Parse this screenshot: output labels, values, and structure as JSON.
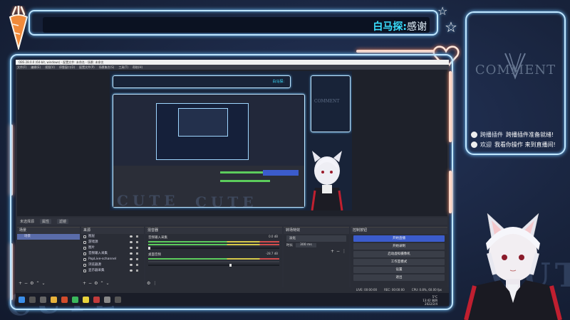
{
  "banner": {
    "name": "白马探:",
    "message": "感谢"
  },
  "comment_panel": {
    "logo_text": "COMMENT",
    "lines": [
      {
        "prefix": "跨播插件",
        "text": "跨播插件准备就绪!"
      },
      {
        "prefix": "欢迎",
        "text": "我看你操作 来到直播间!"
      }
    ]
  },
  "watermark": {
    "text": "CUTE"
  },
  "obs": {
    "title": "OBS 28.0.0 (64-bit, windows) - 配置文件: 未命名 - 场景: 未命名",
    "menu": [
      "文件(F)",
      "编辑(E)",
      "视图(V)",
      "停靠窗口(D)",
      "配置文件(P)",
      "场景集合(S)",
      "工具(T)",
      "帮助(H)"
    ],
    "scene_bar": {
      "label": "未选择源",
      "props": "属性",
      "filters": "滤镜"
    },
    "scenes": {
      "title": "场景",
      "items": [
        "场景"
      ]
    },
    "sources": {
      "title": "来源",
      "items": [
        "图层",
        "游戏源",
        "图片",
        "音频输入采集",
        "PopLive-schannel",
        "浏览器源",
        "显示器采集"
      ]
    },
    "mixer": {
      "title": "混音器",
      "channels": [
        {
          "name": "音频输入采集",
          "db": "0.0 dB",
          "level": 0.0
        },
        {
          "name": "桌面音频",
          "db": "-28.7 dB",
          "level": 0.62
        }
      ]
    },
    "transitions": {
      "title": "转场特效",
      "type": "淡化",
      "duration_label": "时长",
      "duration": "300 ms"
    },
    "controls": {
      "title": "控制按钮",
      "buttons": [
        "开始直播",
        "开始录制",
        "启动虚拟摄像机",
        "工作室模式",
        "设置",
        "退出"
      ]
    },
    "status": {
      "live": "LIVE: 00:00:00",
      "rec": "REC: 00:00:00",
      "cpu": "CPU: 0.8%, 60.00 fps"
    },
    "taskbar": {
      "time": "13:42 周四",
      "date": "2022/2/4",
      "weather": "5°C",
      "weather_label": "CPU温度"
    }
  },
  "colors": {
    "neon_blue": "#bfe6ff",
    "neon_pink": "#ffd8c8",
    "accent_cyan": "#3ae0ff",
    "obs_bg": "#2b2e38",
    "obs_primary": "#3b5ccc"
  },
  "icons": [
    "carrot-icon",
    "star-icon",
    "heart-icon",
    "bunny-v-icon"
  ]
}
